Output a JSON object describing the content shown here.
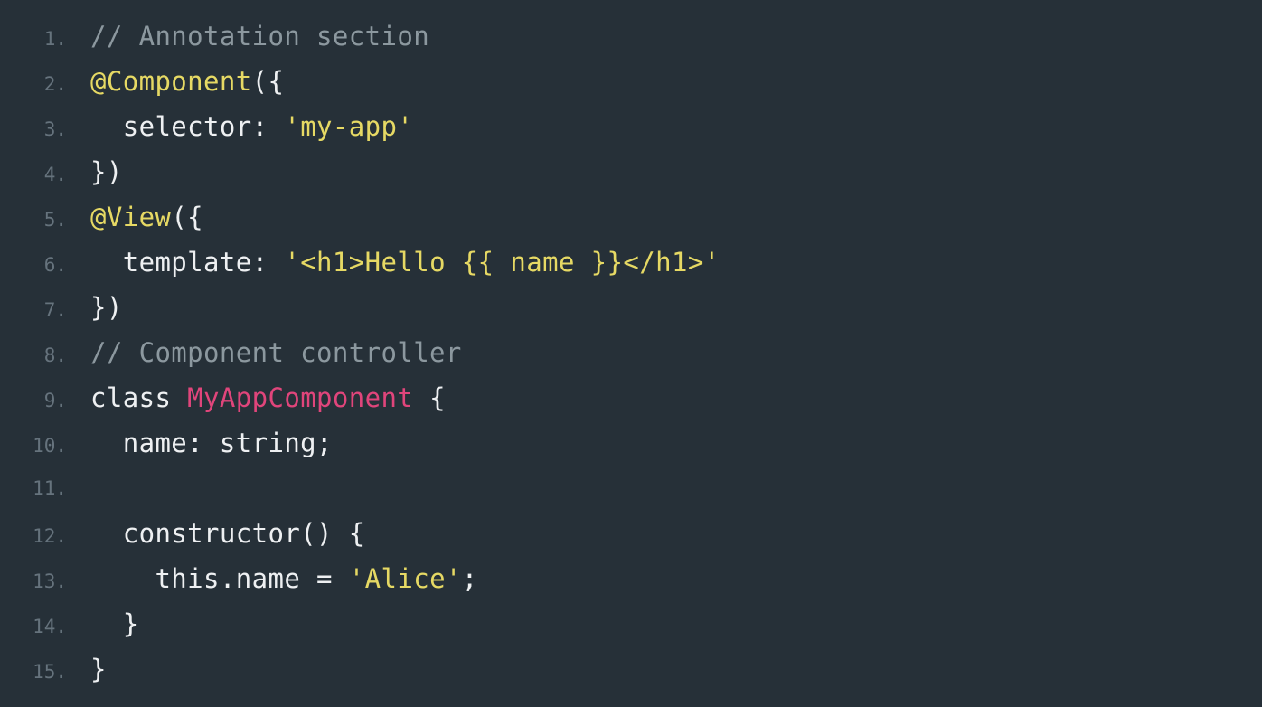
{
  "colors": {
    "background": "#263038",
    "line_number": "#66737d",
    "plain": "#eef0f2",
    "comment": "#8c989f",
    "decorator": "#e6d964",
    "string": "#e6d964",
    "class_name": "#e0457b"
  },
  "lines": [
    {
      "number": "1.",
      "tokens": [
        {
          "type": "comment",
          "text": "// Annotation section"
        }
      ]
    },
    {
      "number": "2.",
      "tokens": [
        {
          "type": "decorator",
          "text": "@Component"
        },
        {
          "type": "plain",
          "text": "({"
        }
      ]
    },
    {
      "number": "3.",
      "tokens": [
        {
          "type": "plain",
          "text": "  selector: "
        },
        {
          "type": "string",
          "text": "'my-app'"
        }
      ]
    },
    {
      "number": "4.",
      "tokens": [
        {
          "type": "plain",
          "text": "})"
        }
      ]
    },
    {
      "number": "5.",
      "tokens": [
        {
          "type": "decorator",
          "text": "@View"
        },
        {
          "type": "plain",
          "text": "({"
        }
      ]
    },
    {
      "number": "6.",
      "tokens": [
        {
          "type": "plain",
          "text": "  template: "
        },
        {
          "type": "string",
          "text": "'<h1>Hello {{ name }}</h1>'"
        }
      ]
    },
    {
      "number": "7.",
      "tokens": [
        {
          "type": "plain",
          "text": "})"
        }
      ]
    },
    {
      "number": "8.",
      "tokens": [
        {
          "type": "comment",
          "text": "// Component controller"
        }
      ]
    },
    {
      "number": "9.",
      "tokens": [
        {
          "type": "plain",
          "text": "class "
        },
        {
          "type": "class",
          "text": "MyAppComponent"
        },
        {
          "type": "plain",
          "text": " {"
        }
      ]
    },
    {
      "number": "10.",
      "tokens": [
        {
          "type": "plain",
          "text": "  name: string;"
        }
      ]
    },
    {
      "number": "11.",
      "tokens": []
    },
    {
      "number": "12.",
      "tokens": [
        {
          "type": "plain",
          "text": "  constructor() {"
        }
      ]
    },
    {
      "number": "13.",
      "tokens": [
        {
          "type": "plain",
          "text": "    this.name = "
        },
        {
          "type": "string",
          "text": "'Alice'"
        },
        {
          "type": "plain",
          "text": ";"
        }
      ]
    },
    {
      "number": "14.",
      "tokens": [
        {
          "type": "plain",
          "text": "  }"
        }
      ]
    },
    {
      "number": "15.",
      "tokens": [
        {
          "type": "plain",
          "text": "}"
        }
      ]
    }
  ]
}
